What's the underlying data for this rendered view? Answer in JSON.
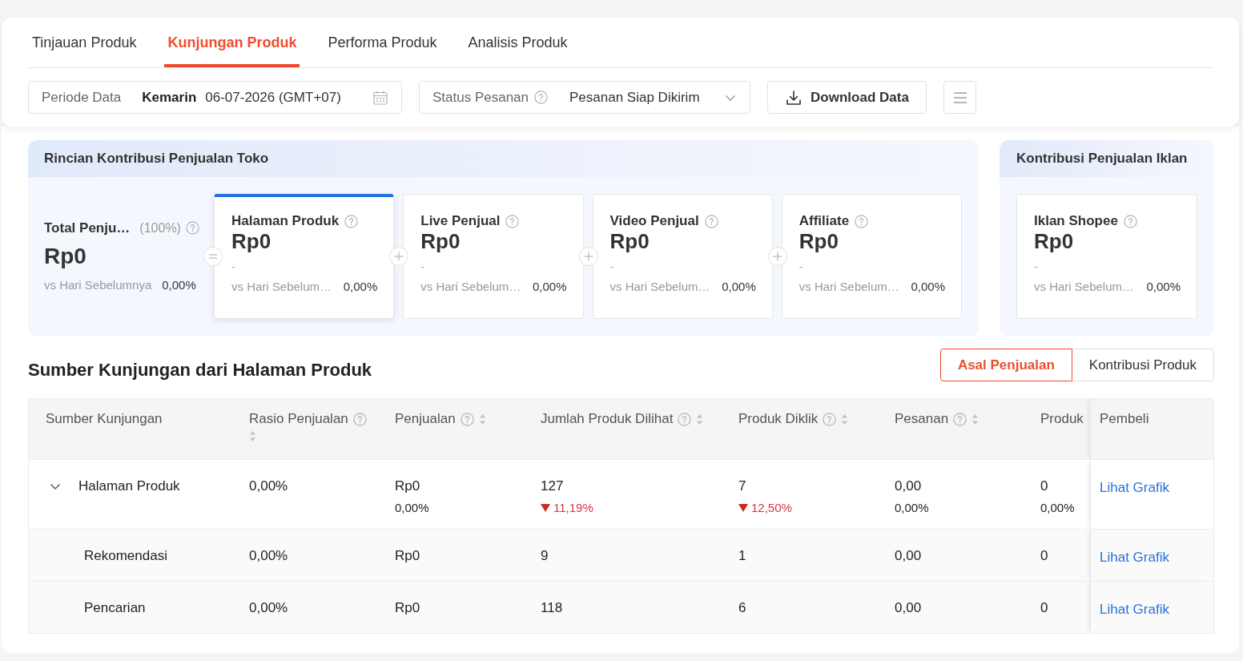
{
  "tabs": [
    {
      "label": "Tinjauan Produk",
      "selected": false
    },
    {
      "label": "Kunjungan Produk",
      "selected": true
    },
    {
      "label": "Performa Produk",
      "selected": false
    },
    {
      "label": "Analisis Produk",
      "selected": false
    }
  ],
  "filters": {
    "period": {
      "label": "Periode Data",
      "preset": "Kemarin",
      "value": "06-07-2026 (GMT+07)"
    },
    "order_status": {
      "label": "Status Pesanan",
      "value": "Pesanan Siap Dikirim"
    },
    "download_button": "Download Data"
  },
  "store_contribution": {
    "title": "Rincian Kontribusi Penjualan Toko",
    "total": {
      "label": "Total Penju…",
      "share": "(100%)",
      "value": "Rp0",
      "compare_label": "vs Hari Sebelumnya",
      "compare_value": "0,00%"
    },
    "cards": [
      {
        "kind": "equals",
        "title": "Halaman Produk",
        "value": "Rp0",
        "note": "-",
        "compare_label": "vs Hari Sebelum…",
        "compare_value": "0,00%",
        "selected": true
      },
      {
        "kind": "plus",
        "title": "Live Penjual",
        "value": "Rp0",
        "note": "-",
        "compare_label": "vs Hari Sebelum…",
        "compare_value": "0,00%",
        "selected": false
      },
      {
        "kind": "plus",
        "title": "Video Penjual",
        "value": "Rp0",
        "note": "-",
        "compare_label": "vs Hari Sebelum…",
        "compare_value": "0,00%",
        "selected": false
      },
      {
        "kind": "plus",
        "title": "Affiliate",
        "value": "Rp0",
        "note": "-",
        "compare_label": "vs Hari Sebelum…",
        "compare_value": "0,00%",
        "selected": false
      }
    ]
  },
  "ads_contribution": {
    "title": "Kontribusi Penjualan Iklan",
    "cards": [
      {
        "title": "Iklan Shopee",
        "value": "Rp0",
        "note": "-",
        "compare_label": "vs Hari Sebelum…",
        "compare_value": "0,00%",
        "selected": false
      }
    ]
  },
  "visit_sources": {
    "title": "Sumber Kunjungan dari Halaman Produk",
    "views": [
      {
        "label": "Asal Penjualan",
        "selected": true
      },
      {
        "label": "Kontribusi Produk",
        "selected": false
      }
    ],
    "table": {
      "columns": [
        {
          "kind": "plain",
          "label": "Sumber Kunjungan"
        },
        {
          "kind": "metric",
          "label": "Rasio Penjualan"
        },
        {
          "kind": "metric",
          "label": "Penjualan"
        },
        {
          "kind": "metric",
          "label": "Jumlah Produk Dilihat"
        },
        {
          "kind": "metric",
          "label": "Produk Diklik"
        },
        {
          "kind": "metric",
          "label": "Pesanan"
        },
        {
          "kind": "plain",
          "label": "Produk"
        },
        {
          "kind": "plain",
          "label": "Pembeli"
        }
      ],
      "rows": [
        {
          "expanded": true,
          "cells": [
            {
              "kind": "source",
              "text": "Halaman Produk"
            },
            {
              "kind": "value",
              "text": "0,00%"
            },
            {
              "kind": "value",
              "text": "Rp0",
              "change": {
                "kind": "flat",
                "text": "0,00%"
              }
            },
            {
              "kind": "value",
              "text": "127",
              "change": {
                "kind": "down",
                "text": "11,19%"
              }
            },
            {
              "kind": "value",
              "text": "7",
              "change": {
                "kind": "down",
                "text": "12,50%"
              }
            },
            {
              "kind": "value",
              "text": "0,00",
              "change": {
                "kind": "flat",
                "text": "0,00%"
              }
            },
            {
              "kind": "value",
              "text": "0",
              "change": {
                "kind": "flat",
                "text": "0,00%"
              }
            },
            {
              "kind": "link",
              "text": "Lihat Grafik"
            }
          ],
          "children": [
            {
              "cells": [
                {
                  "kind": "source",
                  "text": "Rekomendasi"
                },
                {
                  "kind": "value",
                  "text": "0,00%"
                },
                {
                  "kind": "value",
                  "text": "Rp0"
                },
                {
                  "kind": "value",
                  "text": "9"
                },
                {
                  "kind": "value",
                  "text": "1"
                },
                {
                  "kind": "value",
                  "text": "0,00"
                },
                {
                  "kind": "value",
                  "text": "0"
                },
                {
                  "kind": "link",
                  "text": "Lihat Grafik"
                }
              ]
            },
            {
              "cells": [
                {
                  "kind": "source",
                  "text": "Pencarian"
                },
                {
                  "kind": "value",
                  "text": "0,00%"
                },
                {
                  "kind": "value",
                  "text": "Rp0"
                },
                {
                  "kind": "value",
                  "text": "118"
                },
                {
                  "kind": "value",
                  "text": "6"
                },
                {
                  "kind": "value",
                  "text": "0,00"
                },
                {
                  "kind": "value",
                  "text": "0"
                },
                {
                  "kind": "link",
                  "text": "Lihat Grafik"
                }
              ]
            }
          ]
        }
      ]
    }
  }
}
